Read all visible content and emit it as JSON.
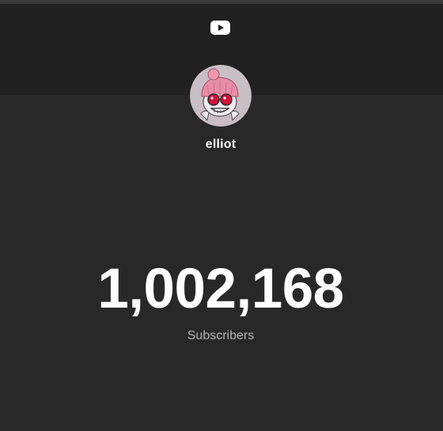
{
  "channel": {
    "name": "elliot",
    "avatar_icon": "cartoon-avatar-pink-beanie-sunglasses"
  },
  "header": {
    "logo_icon": "youtube-play-icon"
  },
  "stats": {
    "subscriber_count": "1,002,168",
    "subscriber_label": "Subscribers"
  },
  "colors": {
    "background": "#282828",
    "header_band": "#212121",
    "count_text": "#ffffff",
    "label_text": "#b3b3b3"
  }
}
